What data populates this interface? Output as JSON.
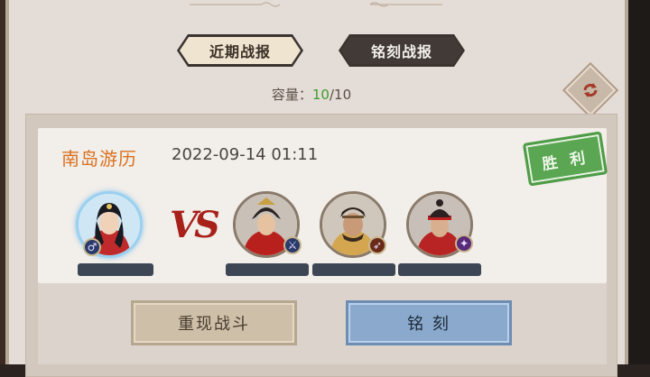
{
  "tabs": {
    "recent_label": "近期战报",
    "inscribed_label": "铭刻战报"
  },
  "capacity": {
    "label": "容量：",
    "current": "10",
    "separator": "/",
    "max": "10"
  },
  "battle": {
    "name": "南岛游历",
    "time": "2022-09-14 01:11",
    "result": "胜 利",
    "vs_text": "VS"
  },
  "player": {
    "gender_icon": "♂"
  },
  "enemies": [
    {
      "badge_icon": "spear-icon"
    },
    {
      "badge_icon": "bow-icon"
    },
    {
      "badge_icon": "staff-icon"
    }
  ],
  "buttons": {
    "replay_label": "重现战斗",
    "inscribe_label": "铭 刻"
  },
  "colors": {
    "battle_name": "#d9711f",
    "capacity_current": "#3e9e2e",
    "victory_stamp": "#5aa653",
    "inscribe_button": "#8aa9cc"
  }
}
